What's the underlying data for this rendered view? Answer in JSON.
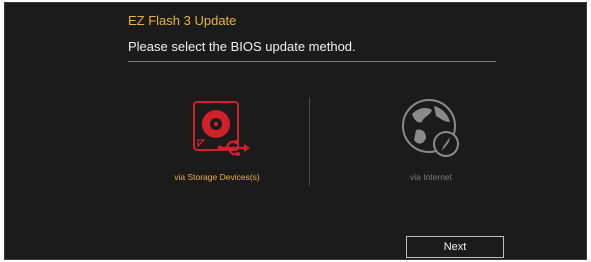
{
  "dialog": {
    "title": "EZ Flash 3 Update",
    "prompt": "Please select the BIOS update method."
  },
  "options": [
    {
      "label": "via Storage Devices(s)",
      "icon": "storage-usb-icon",
      "selected": true
    },
    {
      "label": "via Internet",
      "icon": "globe-icon",
      "selected": false
    }
  ],
  "buttons": {
    "next": "Next"
  },
  "colors": {
    "background": "#1b1b1b",
    "accent": "#e8b33a",
    "selected_icon": "#d0202a",
    "disabled": "#7c7c7c"
  }
}
